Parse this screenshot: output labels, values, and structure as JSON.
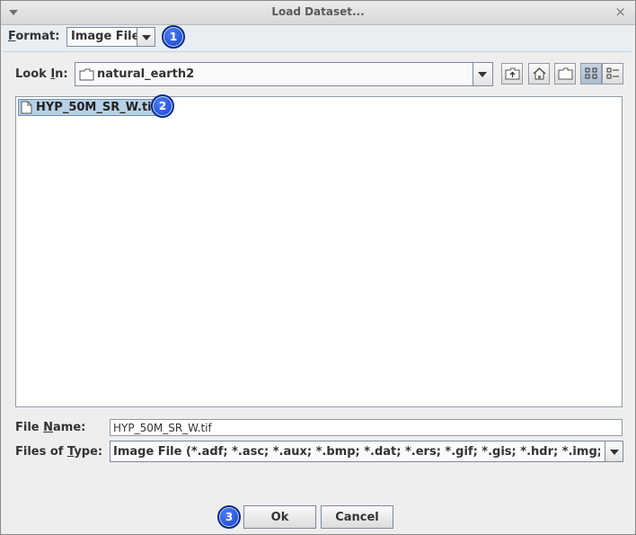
{
  "window": {
    "title": "Load Dataset...",
    "close_glyph": "×"
  },
  "format": {
    "label_mnemonic": "F",
    "label_rest": "ormat:",
    "value": "Image File",
    "badge": "1"
  },
  "lookin": {
    "label_pre": "Look ",
    "label_mnemonic": "I",
    "label_post": "n:",
    "value": "natural_earth2"
  },
  "toolbar": {
    "buttons": [
      {
        "icon": "up-folder-icon"
      },
      {
        "icon": "home-icon"
      },
      {
        "icon": "new-folder-icon"
      },
      {
        "icon": "list-view-icon",
        "selected": true
      },
      {
        "icon": "details-view-icon",
        "selected": false
      }
    ]
  },
  "files": {
    "items": [
      {
        "name": "HYP_50M_SR_W.tif",
        "selected": true,
        "badge": "2"
      }
    ]
  },
  "filename": {
    "label_pre": "File ",
    "label_mnemonic": "N",
    "label_post": "ame:",
    "value": "HYP_50M_SR_W.tif"
  },
  "filetype": {
    "label_pre": "Files of ",
    "label_mnemonic": "T",
    "label_post": "ype:",
    "value": "Image File (*.adf; *.asc; *.aux; *.bmp; *.dat; *.ers; *.gif; *.gis; *.hdr; *.img; *...."
  },
  "buttons": {
    "ok_label": "Ok",
    "cancel_label": "Cancel",
    "badge": "3"
  },
  "colors": {
    "badge_fill": "#1f4fd8",
    "selection": "#b8cfe5"
  }
}
